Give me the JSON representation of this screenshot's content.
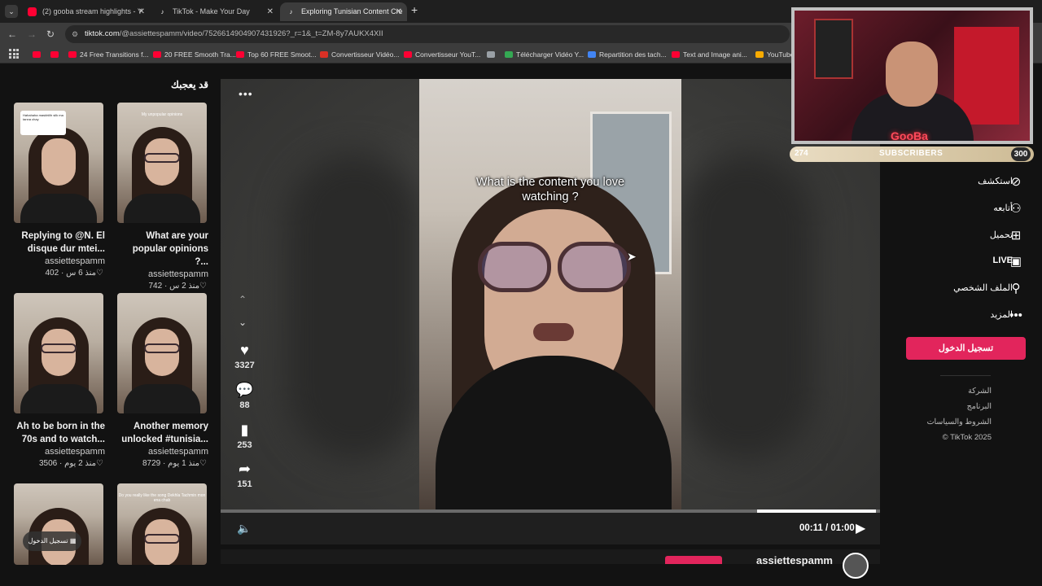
{
  "browser": {
    "tabs": [
      {
        "title": "(2) gooba stream highlights - Y",
        "icon": "youtube-icon",
        "color": "#ff0033"
      },
      {
        "title": "TikTok - Make Your Day",
        "icon": "tiktok-icon",
        "color": "#ffffff"
      },
      {
        "title": "Exploring Tunisian Content Cre",
        "icon": "tiktok-icon",
        "color": "#ffffff"
      }
    ],
    "new_tab": "+",
    "url_domain": "tiktok.com",
    "url_path": "/@assiettespamm/video/7526614904907431926?_r=1&_t=ZM-8y7AUKX4XII",
    "bookmarks": [
      {
        "label": "",
        "color": "#ff0033"
      },
      {
        "label": "",
        "color": "#ff0033"
      },
      {
        "label": "24 Free Transitions f...",
        "color": "#ff0033"
      },
      {
        "label": "20 FREE Smooth Tra...",
        "color": "#ff0033"
      },
      {
        "label": "Top 60 FREE Smoot...",
        "color": "#ff0033"
      },
      {
        "label": "Convertisseur Vidéo...",
        "color": "#d93025"
      },
      {
        "label": "Convertisseur YouT...",
        "color": "#ff0033"
      },
      {
        "label": "",
        "color": "#9aa0a6"
      },
      {
        "label": "Télécharger Vidéo Y...",
        "color": "#34a853"
      },
      {
        "label": "Repartition des tach...",
        "color": "#4285f4"
      },
      {
        "label": "Text and Image ani...",
        "color": "#ff0033"
      },
      {
        "label": "YouTube",
        "color": "#f9ab00"
      }
    ]
  },
  "recommended": {
    "title": "قد يعجبك",
    "cards": [
      {
        "title_line1": "Replying to @N. El",
        "title_line2": "disque dur mtei...",
        "author": "assiettespamm",
        "likes": "402",
        "age": "منذ 6 س",
        "thumb_caption": "Hahahaha maskhilih silk ma tanna chay"
      },
      {
        "title_line1": "What are your",
        "title_line2": "popular opinions ?...",
        "author": "assiettespamm",
        "likes": "742",
        "age": "منذ 2 س",
        "thumb_caption": "My unpopular opinions"
      },
      {
        "title_line1": "Ah to be born in the",
        "title_line2": "70s and to watch...",
        "author": "assiettespamm",
        "likes": "3506",
        "age": "منذ 2 يوم",
        "thumb_caption": ""
      },
      {
        "title_line1": "Another memory",
        "title_line2": "unlocked #tunisia...",
        "author": "assiettespamm",
        "likes": "8729",
        "age": "منذ 1 يوم",
        "thumb_caption": ""
      },
      {
        "title_line1": "",
        "title_line2": "",
        "author": "",
        "likes": "",
        "age": "",
        "thumb_caption": ""
      },
      {
        "title_line1": "",
        "title_line2": "",
        "author": "",
        "likes": "",
        "age": "",
        "thumb_caption": "Do you really like the song Dekhla Tachmin mon ena chab"
      }
    ],
    "login_chip": "تسجيل الدخول"
  },
  "player": {
    "caption_line1": "What is the content you love",
    "caption_line2": "watching ?",
    "more_label": "•••",
    "likes": "3327",
    "comments": "88",
    "saves": "253",
    "shares": "151",
    "time": "00:11 / 01:00",
    "progress_fraction": 0.18,
    "author": "assiettespamm"
  },
  "sidebar": {
    "items": [
      {
        "label": "استكشف",
        "icon": "compass-icon"
      },
      {
        "label": "أتابعه",
        "icon": "follow-icon"
      },
      {
        "label": "تحميل",
        "icon": "upload-icon"
      },
      {
        "label": "LIVE",
        "icon": "live-icon"
      },
      {
        "label": "الملف الشخصي",
        "icon": "profile-icon"
      },
      {
        "label": "المزيد",
        "icon": "more-icon"
      }
    ],
    "login_button": "تسجيل الدخول",
    "footer": [
      "الشركة",
      "البرنامج",
      "الشروط والسياسات",
      "© TikTok 2025"
    ]
  },
  "stream_overlay": {
    "logo": "GooBa",
    "subscribers_current": "274",
    "subscribers_label": "SUBSCRIBERS",
    "subscribers_goal": "300"
  }
}
